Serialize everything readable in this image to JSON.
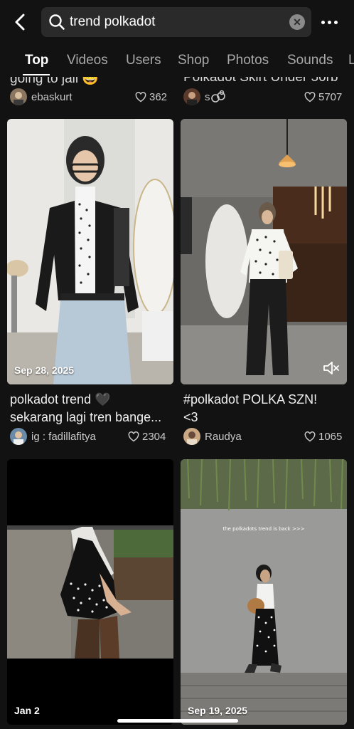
{
  "search": {
    "query": "trend polkadot",
    "clear_symbol": "✕"
  },
  "tabs": [
    {
      "label": "Top"
    },
    {
      "label": "Videos"
    },
    {
      "label": "Users"
    },
    {
      "label": "Shop"
    },
    {
      "label": "Photos"
    },
    {
      "label": "Sounds"
    },
    {
      "label": "L"
    }
  ],
  "previous_row": [
    {
      "caption": "going to jail 😅",
      "user": "ebaskurt",
      "likes": "362"
    },
    {
      "caption": "Polkadot Skirt Under 50rb",
      "user": "s",
      "likes": "5707"
    }
  ],
  "posts": [
    {
      "date": "Sep 28, 2025",
      "caption_line1": "polkadot trend 🖤",
      "caption_line2": "sekarang lagi tren bange...",
      "user": "ig : fadillafitya",
      "likes": "2304"
    },
    {
      "caption_line1": "#polkadot POLKA SZN!",
      "caption_line2": "<3",
      "user": "Raudya",
      "likes": "1065",
      "icon": "speaker-muted-icon"
    },
    {
      "date": "Jan 2"
    },
    {
      "date": "Sep 19, 2025",
      "overlay_text": "the polkadots trend is back >>>"
    }
  ],
  "colors": {
    "background": "#121212",
    "search_bg": "#2a2a2a",
    "muted_text": "#a8a8a8"
  }
}
